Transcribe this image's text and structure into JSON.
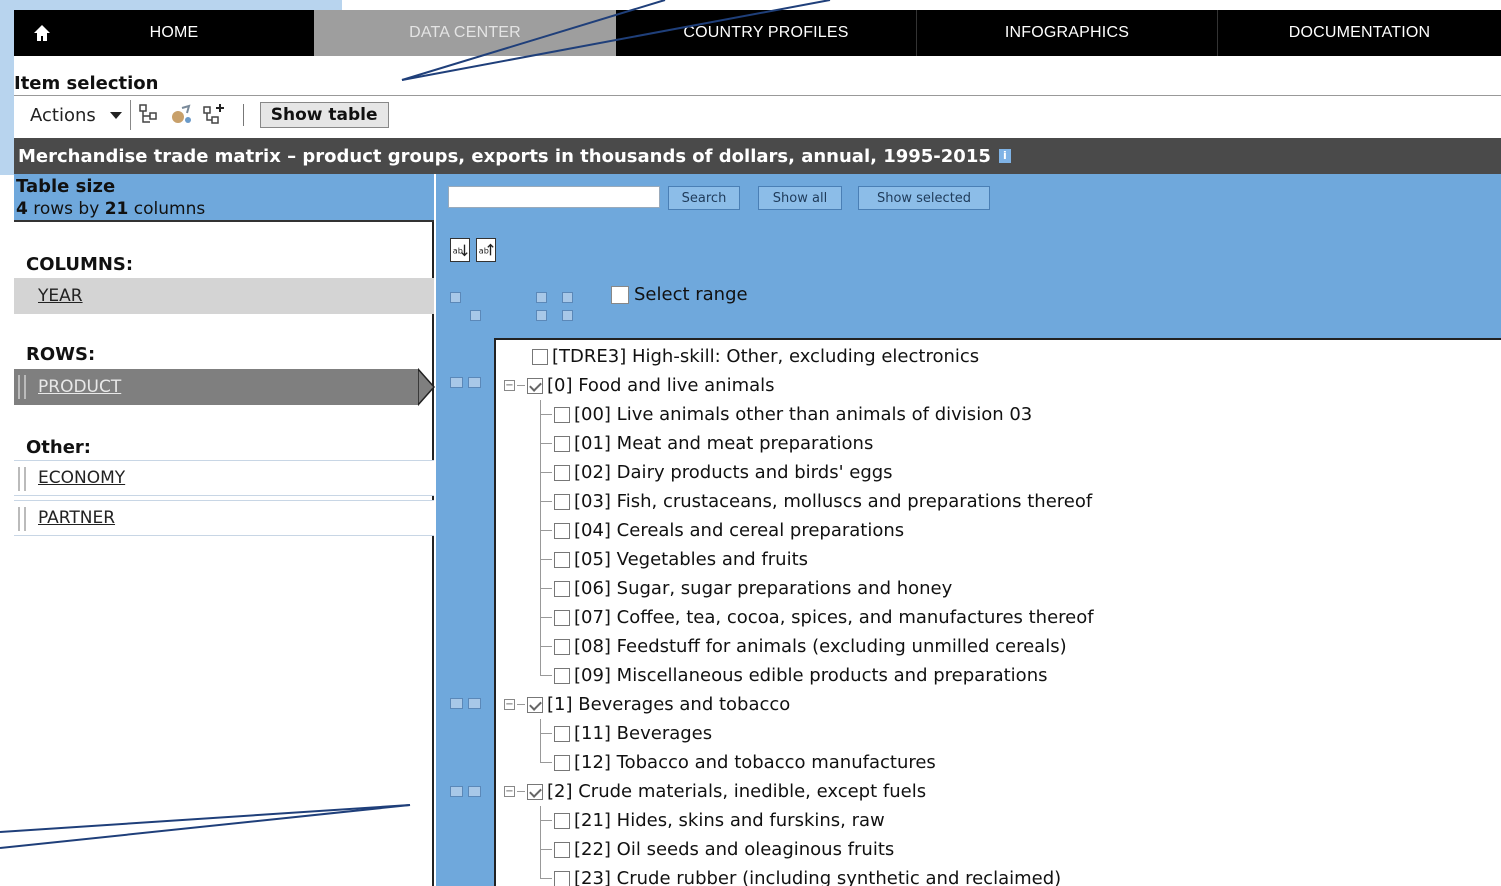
{
  "nav": {
    "items": [
      "HOME",
      "DATA CENTER",
      "COUNTRY PROFILES",
      "INFOGRAPHICS",
      "DOCUMENTATION"
    ],
    "active": "DATA CENTER"
  },
  "item_selection": "Item selection",
  "toolbar": {
    "actions_label": "Actions",
    "show_table_label": "Show table"
  },
  "title": "Merchandise trade matrix – product groups, exports in thousands of dollars, annual, 1995-2015",
  "table_size": {
    "title": "Table size",
    "rows": "4",
    "rows_text": " rows by ",
    "cols": "21",
    "cols_text": " columns"
  },
  "left": {
    "columns_label": "COLUMNS:",
    "year": "YEAR",
    "rows_label": "ROWS:",
    "product": "PRODUCT",
    "other_label": "Other:",
    "economy": "ECONOMY",
    "partner": "PARTNER"
  },
  "right": {
    "search_value": "",
    "search_btn": "Search",
    "show_all_btn": "Show all",
    "show_selected_btn": "Show selected",
    "select_range": "Select range"
  },
  "tree": [
    {
      "label": "[TDRE3] High-skill: Other, excluding electronics",
      "level": 0,
      "checked": false
    },
    {
      "label": "[0] Food and live animals",
      "level": 1,
      "checked": true,
      "group": true
    },
    {
      "label": "[00] Live animals other than animals of division 03",
      "level": 2,
      "checked": false
    },
    {
      "label": "[01] Meat and meat preparations",
      "level": 2,
      "checked": false
    },
    {
      "label": "[02] Dairy products and birds' eggs",
      "level": 2,
      "checked": false
    },
    {
      "label": "[03] Fish, crustaceans, molluscs and preparations thereof",
      "level": 2,
      "checked": false
    },
    {
      "label": "[04] Cereals and cereal preparations",
      "level": 2,
      "checked": false
    },
    {
      "label": "[05] Vegetables and fruits",
      "level": 2,
      "checked": false
    },
    {
      "label": "[06] Sugar, sugar preparations and honey",
      "level": 2,
      "checked": false
    },
    {
      "label": "[07] Coffee, tea, cocoa, spices, and manufactures thereof",
      "level": 2,
      "checked": false
    },
    {
      "label": "[08] Feedstuff for animals (excluding unmilled cereals)",
      "level": 2,
      "checked": false
    },
    {
      "label": "[09] Miscellaneous edible products and preparations",
      "level": 2,
      "checked": false
    },
    {
      "label": "[1] Beverages and tobacco",
      "level": 1,
      "checked": true,
      "group": true
    },
    {
      "label": "[11] Beverages",
      "level": 2,
      "checked": false
    },
    {
      "label": "[12] Tobacco and tobacco manufactures",
      "level": 2,
      "checked": false
    },
    {
      "label": "[2] Crude materials, inedible, except fuels",
      "level": 1,
      "checked": true,
      "group": true
    },
    {
      "label": "[21] Hides, skins and furskins, raw",
      "level": 2,
      "checked": false
    },
    {
      "label": "[22] Oil seeds and oleaginous fruits",
      "level": 2,
      "checked": false
    },
    {
      "label": "[23] Crude rubber (including synthetic and reclaimed)",
      "level": 2,
      "checked": false
    }
  ],
  "colors": {
    "nav_bg": "#000000",
    "nav_active": "#9e9e9e",
    "panel_blue": "#6fa8dc",
    "title_bg": "#4a4a4a",
    "callout": "#1f3f7a"
  }
}
